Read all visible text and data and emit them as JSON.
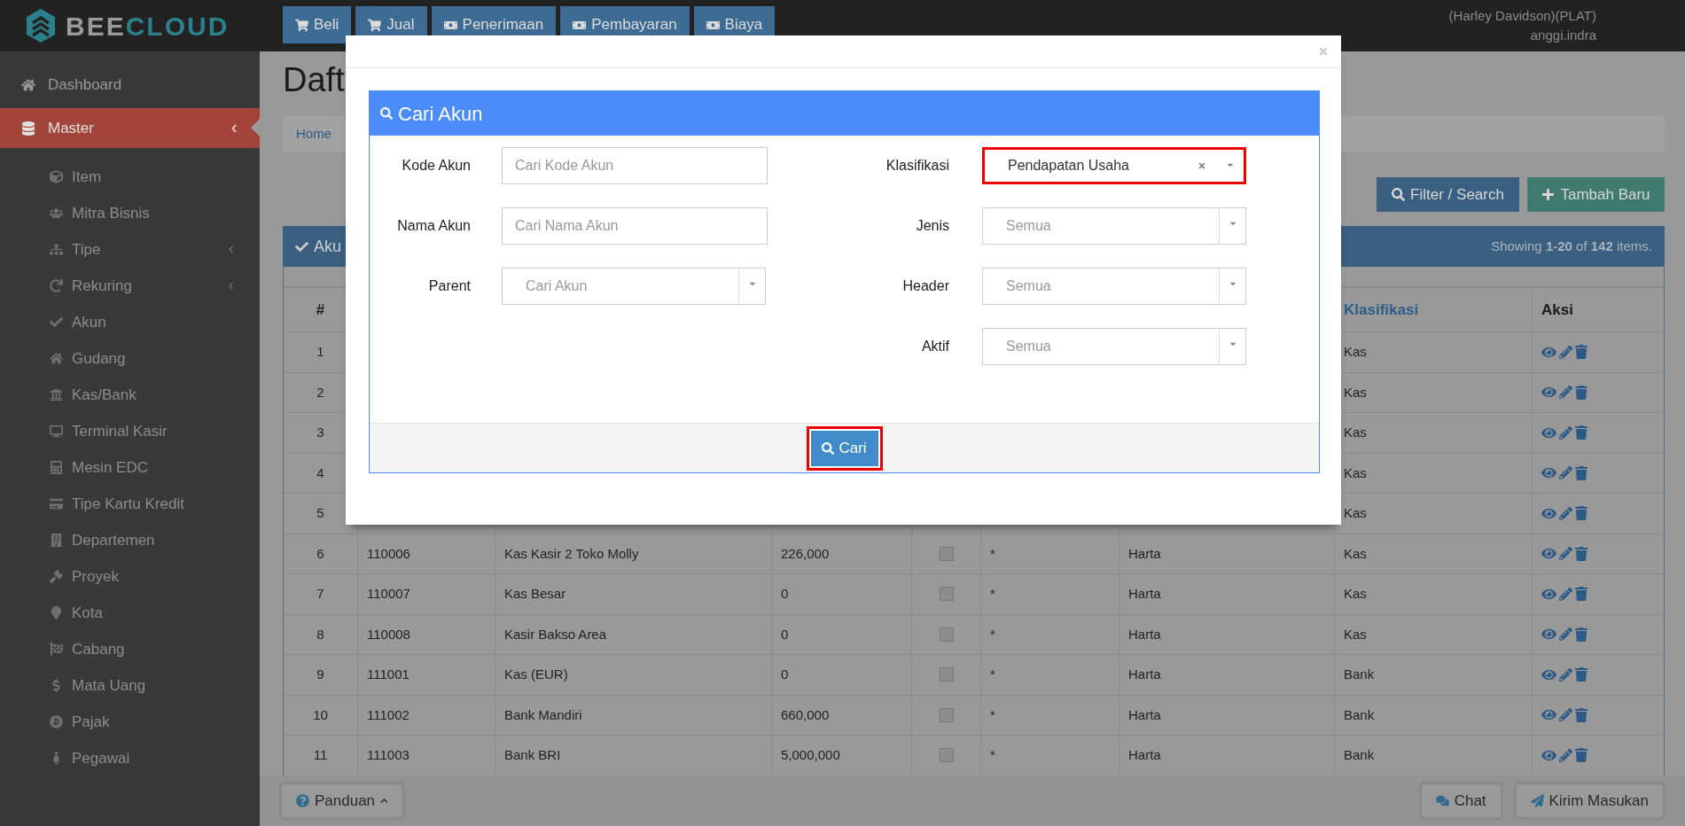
{
  "topbar": {
    "logo": {
      "part_1": "BEE",
      "part_2": "CLOUD"
    },
    "nav": [
      {
        "label": "Beli"
      },
      {
        "label": "Jual"
      },
      {
        "label": "Penerimaan"
      },
      {
        "label": "Pembayaran"
      },
      {
        "label": "Biaya"
      }
    ],
    "user": {
      "company": "(Harley Davidson)(PLAT)",
      "name": "anggi.indra"
    }
  },
  "sidebar": {
    "items": [
      {
        "label": "Dashboard",
        "selected": false,
        "has_children": false
      },
      {
        "label": "Master",
        "selected": true,
        "has_children": true,
        "children": [
          {
            "label": "Item",
            "has_children": false
          },
          {
            "label": "Mitra Bisnis",
            "has_children": false
          },
          {
            "label": "Tipe",
            "has_children": true
          },
          {
            "label": "Rekuring",
            "has_children": true
          },
          {
            "label": "Akun",
            "has_children": false
          },
          {
            "label": "Gudang",
            "has_children": false
          },
          {
            "label": "Kas/Bank",
            "has_children": false
          },
          {
            "label": "Terminal Kasir",
            "has_children": false
          },
          {
            "label": "Mesin EDC",
            "has_children": false
          },
          {
            "label": "Tipe Kartu Kredit",
            "has_children": false
          },
          {
            "label": "Departemen",
            "has_children": false
          },
          {
            "label": "Proyek",
            "has_children": false
          },
          {
            "label": "Kota",
            "has_children": false
          },
          {
            "label": "Cabang",
            "has_children": false
          },
          {
            "label": "Mata Uang",
            "has_children": false
          },
          {
            "label": "Pajak",
            "has_children": false
          },
          {
            "label": "Pegawai",
            "has_children": false
          }
        ]
      }
    ]
  },
  "page": {
    "title": "Daft",
    "breadcrumb": "Home",
    "buttons": [
      {
        "label": "Filter / Search",
        "kind": "filter"
      },
      {
        "label": "Tambah Baru",
        "kind": "add"
      }
    ]
  },
  "panel": {
    "title": "Aku",
    "summary": "Showing **1-20** of **142** items."
  },
  "table": {
    "columns": [
      {
        "label": "#",
        "sortable": false
      },
      {
        "label": "Klasifikasi",
        "sortable": true
      },
      {
        "label": "Aksi",
        "sortable": false
      }
    ],
    "rows": [
      {
        "no": "1",
        "klasifikasi": "Kas"
      },
      {
        "no": "2",
        "klasifikasi": "Kas"
      },
      {
        "no": "3",
        "klasifikasi": "Kas"
      },
      {
        "no": "4",
        "klasifikasi": "Kas"
      },
      {
        "no": "5",
        "klasifikasi": "Kas"
      },
      {
        "no": "6",
        "kode": "110006",
        "nama": "Kas Kasir 2 Toko Molly",
        "saldo": "226,000",
        "checked": false,
        "mark": "*",
        "tipe": "Harta",
        "klasifikasi": "Kas"
      },
      {
        "no": "7",
        "kode": "110007",
        "nama": "Kas Besar",
        "saldo": "0",
        "checked": false,
        "mark": "*",
        "tipe": "Harta",
        "klasifikasi": "Kas"
      },
      {
        "no": "8",
        "kode": "110008",
        "nama": "Kasir Bakso Area",
        "saldo": "0",
        "checked": false,
        "mark": "*",
        "tipe": "Harta",
        "klasifikasi": "Kas"
      },
      {
        "no": "9",
        "kode": "111001",
        "nama": "Kas (EUR)",
        "saldo": "0",
        "checked": false,
        "mark": "*",
        "tipe": "Harta",
        "klasifikasi": "Bank"
      },
      {
        "no": "10",
        "kode": "111002",
        "nama": "Bank Mandiri",
        "saldo": "660,000",
        "checked": false,
        "mark": "*",
        "tipe": "Harta",
        "klasifikasi": "Bank"
      },
      {
        "no": "11",
        "kode": "111003",
        "nama": "Bank BRI",
        "saldo": "5,000,000",
        "checked": false,
        "mark": "*",
        "tipe": "Harta",
        "klasifikasi": "Bank"
      }
    ]
  },
  "footer": {
    "buttons": [
      {
        "label": "Panduan",
        "kind": "help"
      },
      {
        "label": "Chat",
        "kind": "chat"
      },
      {
        "label": "Kirim Masukan",
        "kind": "feedback"
      }
    ]
  },
  "modal": {
    "title": "Cari Akun",
    "left_fields": [
      {
        "label": "Kode Akun",
        "kind": "text",
        "placeholder": "Cari Kode Akun",
        "highlighted": false
      },
      {
        "label": "Nama Akun",
        "kind": "text",
        "placeholder": "Cari Nama Akun",
        "highlighted": false
      },
      {
        "label": "Parent",
        "kind": "select",
        "placeholder": "Cari Akun",
        "highlighted": false
      }
    ],
    "right_fields": [
      {
        "label": "Klasifikasi",
        "kind": "select",
        "value": "Pendapatan Usaha",
        "highlighted": true
      },
      {
        "label": "Jenis",
        "kind": "select",
        "placeholder": "Semua",
        "highlighted": false
      },
      {
        "label": "Header",
        "kind": "select",
        "placeholder": "Semua",
        "highlighted": false
      },
      {
        "label": "Aktif",
        "kind": "select",
        "placeholder": "Semua",
        "highlighted": false
      }
    ],
    "search_button": {
      "label": "Cari",
      "highlighted": true
    }
  }
}
